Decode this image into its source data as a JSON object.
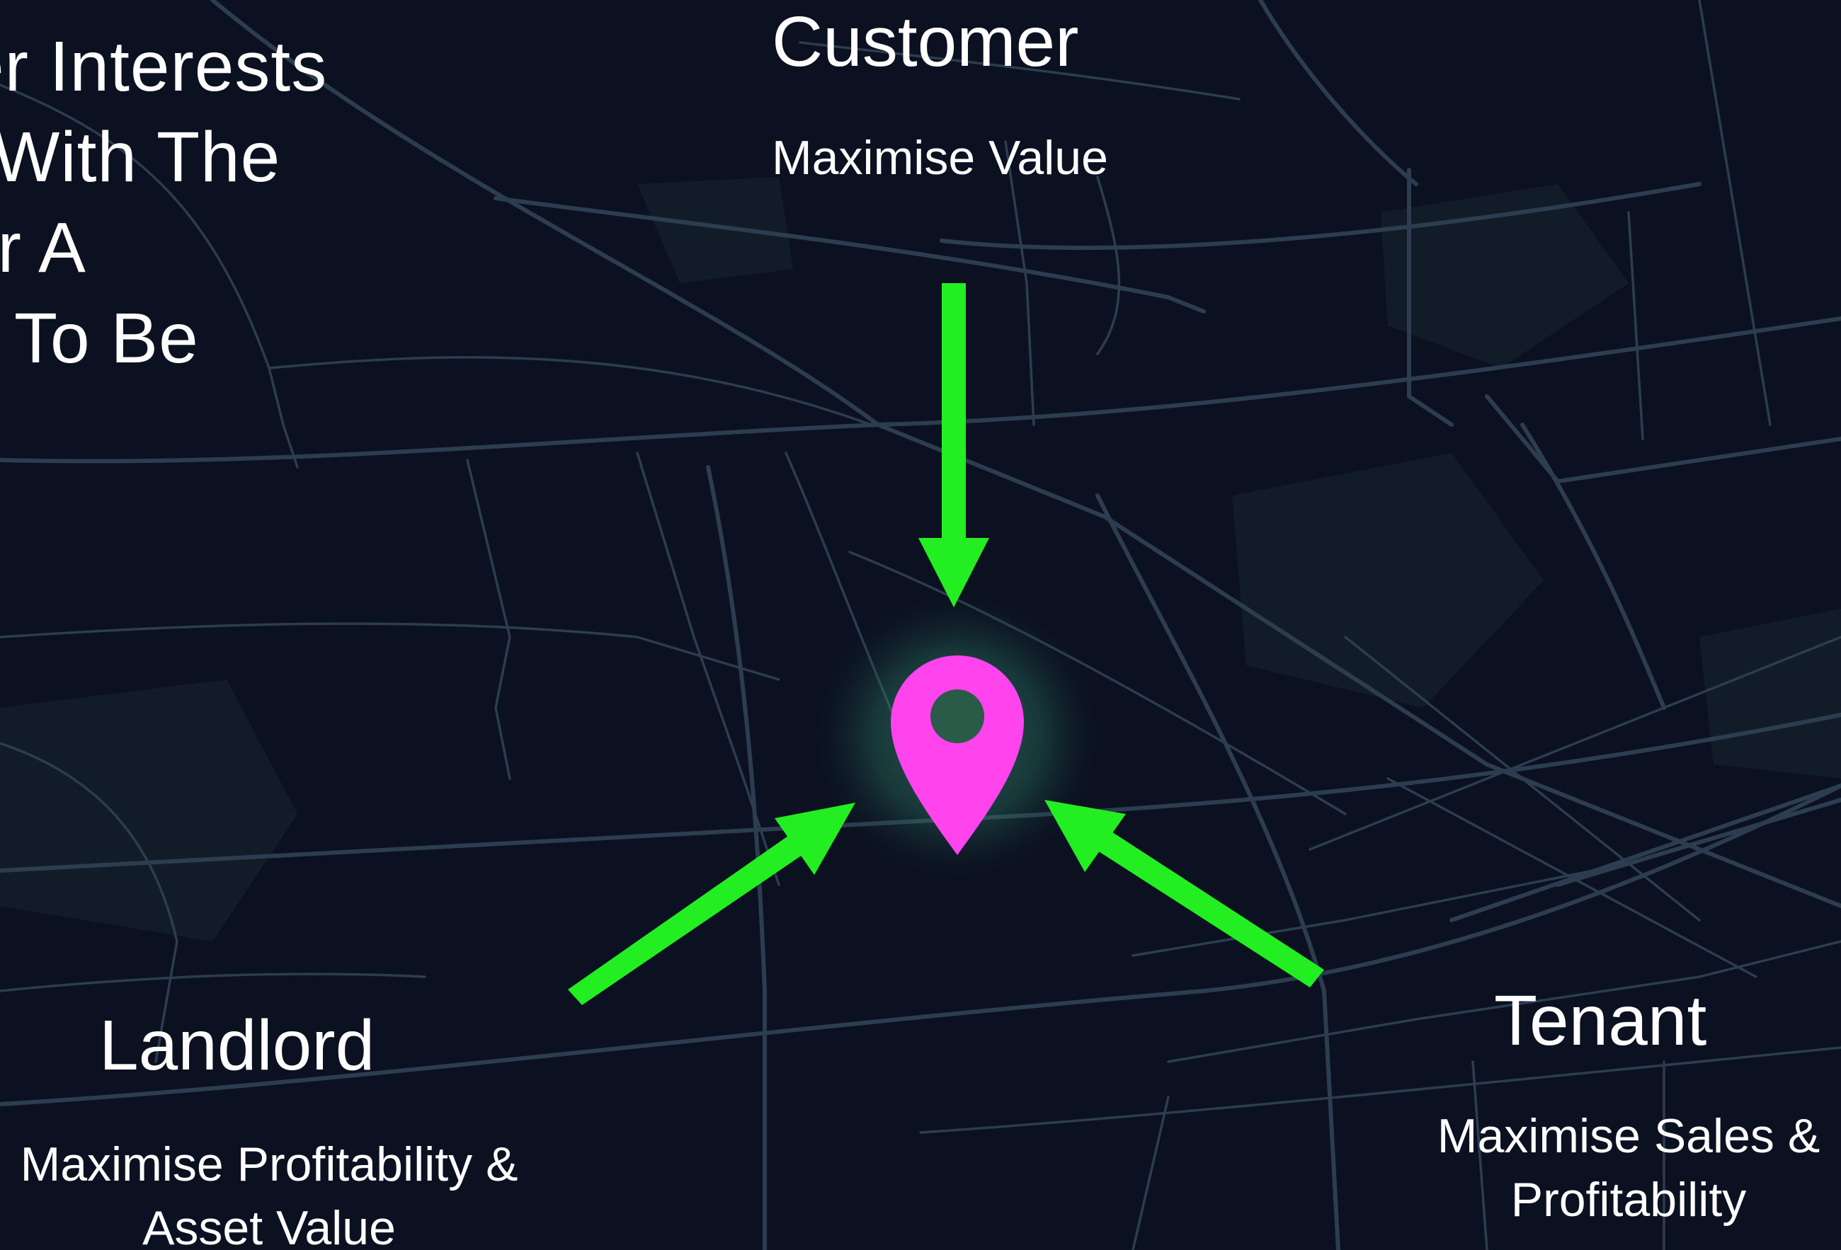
{
  "intro": {
    "lines": [
      "er Interests",
      "With The",
      "or A",
      "To Be"
    ]
  },
  "customer": {
    "title": "Customer",
    "subtitle": "Maximise Value"
  },
  "landlord": {
    "title": "Landlord",
    "subtitle": "Maximise Profitability & Asset Value"
  },
  "tenant": {
    "title": "Tenant",
    "subtitle": "Maximise Sales & Profitability"
  },
  "icons": {
    "pin": "location-pin-icon",
    "arrows": [
      "arrow-down-icon",
      "arrow-up-right-icon",
      "arrow-up-left-icon"
    ]
  },
  "colors": {
    "background": "#0b1120",
    "road": "#2b3d4f",
    "arrow": "#22ee22",
    "pin": "#ff44ee",
    "glow": "#3fa884",
    "text": "#ffffff"
  }
}
